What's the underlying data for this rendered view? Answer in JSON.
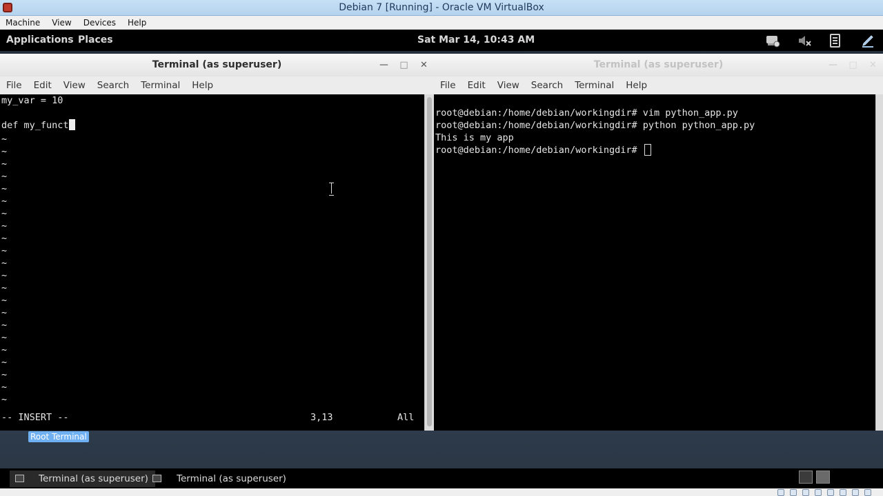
{
  "host_window": {
    "title": "Debian 7 [Running] - Oracle VM VirtualBox",
    "menu": [
      "Machine",
      "View",
      "Devices",
      "Help"
    ]
  },
  "gnome_top_panel": {
    "applications": "Applications",
    "places": "Places",
    "clock": "Sat Mar 14, 10:43 AM",
    "tray_icons": [
      "network-icon",
      "volume-muted-icon",
      "clipboard-icon",
      "pen-icon"
    ]
  },
  "left_terminal": {
    "title": "Terminal (as superuser)",
    "menu": [
      "File",
      "Edit",
      "View",
      "Search",
      "Terminal",
      "Help"
    ],
    "lines": [
      "my_var = 10",
      "",
      "def my_funct"
    ],
    "empty_line_marker": "~",
    "status_mode": "-- INSERT --",
    "status_position": "3,13",
    "status_scroll": "All"
  },
  "right_terminal": {
    "title": "Terminal (as superuser)",
    "menu": [
      "File",
      "Edit",
      "View",
      "Search",
      "Terminal",
      "Help"
    ],
    "lines": [
      "",
      "root@debian:/home/debian/workingdir# vim python_app.py",
      "root@debian:/home/debian/workingdir# python python_app.py",
      "This is my app",
      "root@debian:/home/debian/workingdir# "
    ]
  },
  "desktop": {
    "label": "Root Terminal"
  },
  "taskbar": {
    "tasks": [
      "Terminal (as superuser)",
      "Terminal (as superuser)"
    ]
  },
  "colors": {
    "terminal_bg": "#000000",
    "terminal_fg": "#e6e6e6",
    "vb_title_bg": "#c6e0f5",
    "desktop_label_bg": "#6fb0f2"
  }
}
